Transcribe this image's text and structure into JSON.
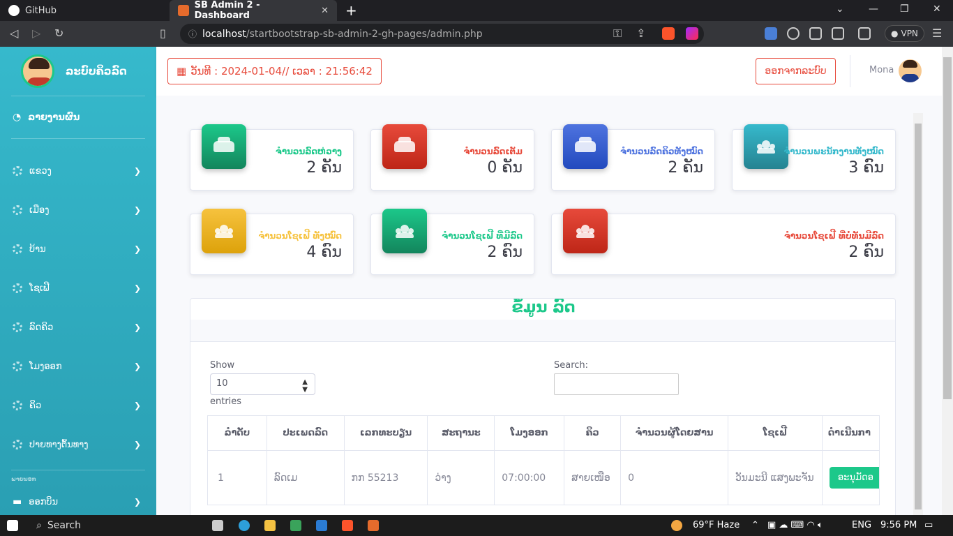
{
  "browser": {
    "tabs": [
      {
        "label": "GitHub"
      },
      {
        "label": "SB Admin 2 - Dashboard"
      }
    ],
    "url_host": "localhost",
    "url_path": "/startbootstrap-sb-admin-2-gh-pages/admin.php",
    "vpn_label": "VPN"
  },
  "sidebar": {
    "brand": "ລະບົບຄິວລົດ",
    "dashboard": "ລາຍງານຜົນ",
    "items": [
      {
        "label": "ແຂວງ"
      },
      {
        "label": "ເມືອງ"
      },
      {
        "label": "ບ້ານ"
      },
      {
        "label": "ໂຊເຟີ"
      },
      {
        "label": "ລົດຄິວ"
      },
      {
        "label": "ໂມງອອກ"
      },
      {
        "label": "ຄິວ"
      },
      {
        "label": "ປາຍທາງຕົ້ນທາງ"
      }
    ],
    "heading": "ພາຍນອກ",
    "bottom_item": "ອອກບິນ"
  },
  "topbar": {
    "datetime": "ວັນທີ : 2024-01-04// ເວລາ : 21:56:42",
    "logout": "ອອກຈາກລະບົບ",
    "username": "Mona"
  },
  "stats": [
    {
      "label": "ຈຳນວນລົດຫ່ວາງ",
      "value": "2 ຄັນ",
      "color": "#1cc88a"
    },
    {
      "label": "ຈຳນວນລົດເຕັມ",
      "value": "0 ຄັນ",
      "color": "#e74a3b"
    },
    {
      "label": "ຈຳນວນລົດຄິວທັງໝົດ",
      "value": "2 ຄັນ",
      "color": "#4e73df"
    },
    {
      "label": "ຈຳນວນພະນັກງານທັງໝົດ",
      "value": "3 ຄົນ",
      "color": "#36b9cc"
    },
    {
      "label": "ຈຳນວນໂຊເຟີ ທັງໝົດ",
      "value": "4 ຄົນ",
      "color": "#f6c23e"
    },
    {
      "label": "ຈຳນວນໂຊເຟີ ທີ່ມີລົດ",
      "value": "2 ຄົນ",
      "color": "#1cc88a"
    },
    {
      "label": "ຈຳນວນໂຊເຟີ ທີ່ບໍ່ທັນມີລົດ",
      "value": "2 ຄົນ",
      "color": "#e74a3b"
    }
  ],
  "table_card": {
    "title": "ຂໍ້ມູນ ລົດ",
    "show_label": "Show",
    "entries_value": "10",
    "entries_label": "entries",
    "search_label": "Search:",
    "columns": [
      "ລຳດັບ",
      "ປະເພດລົດ",
      "ເລກທະບຽນ",
      "ສະຖານະ",
      "ໂມງອອກ",
      "ຄິວ",
      "ຈຳນວນຜູ້ໂດຍສານ",
      "ໂຊເຟີ",
      "ດຳເນີນກາ"
    ],
    "rows": [
      {
        "no": "1",
        "type": "ລົດເມ",
        "plate": "ກກ 55213",
        "status": "ວ່າງ",
        "depart": "07:00:00",
        "queue": "ສາຍເໜືອ",
        "passengers": "0",
        "driver": "ວັນມະນີ ແສງພະຈັນ",
        "action": "ອະນຸມັດອ"
      }
    ]
  },
  "taskbar": {
    "search": "Search",
    "weather": "69°F  Haze",
    "lang": "ENG",
    "time": "9:56 PM"
  }
}
